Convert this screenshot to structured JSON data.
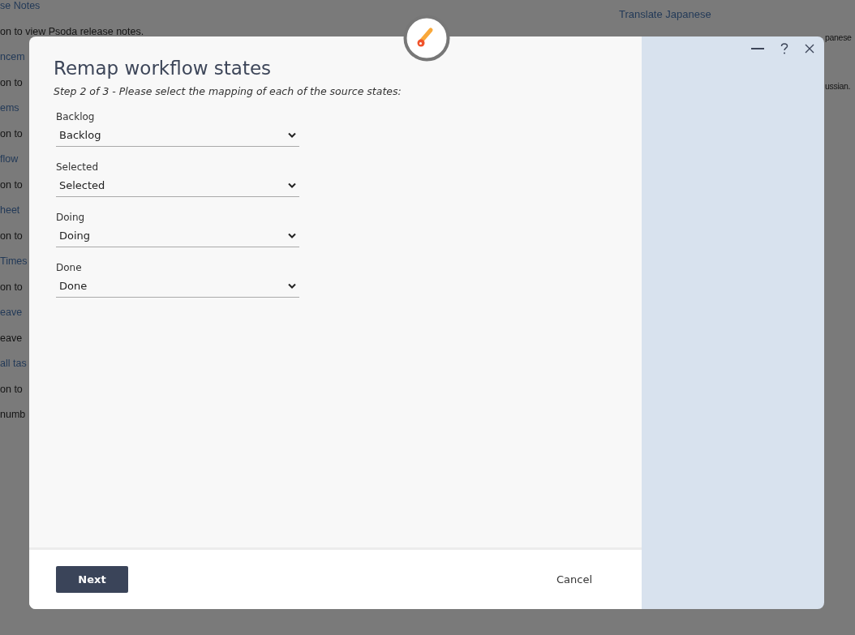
{
  "background_page": {
    "left_items": [
      {
        "kind": "link",
        "text": "se Notes"
      },
      {
        "kind": "text",
        "text": "on to view Psoda release notes."
      },
      {
        "kind": "link",
        "text": "ncem"
      },
      {
        "kind": "text",
        "text": "on to"
      },
      {
        "kind": "link",
        "text": "ems"
      },
      {
        "kind": "text",
        "text": "on to"
      },
      {
        "kind": "link",
        "text": "flow"
      },
      {
        "kind": "text",
        "text": "on to"
      },
      {
        "kind": "link",
        "text": "heet"
      },
      {
        "kind": "text",
        "text": "on to"
      },
      {
        "kind": "link",
        "text": "Times"
      },
      {
        "kind": "text",
        "text": "on to"
      },
      {
        "kind": "link",
        "text": "eave"
      },
      {
        "kind": "text",
        "text": "eave"
      },
      {
        "kind": "link",
        "text": "all tas"
      },
      {
        "kind": "text",
        "text": "on to"
      },
      {
        "kind": "text",
        "text": "numb"
      }
    ],
    "right_items": [
      {
        "kind": "link",
        "text": "Translate Japanese"
      }
    ],
    "right_fragments": [
      "panese",
      "ussian."
    ]
  },
  "dialog": {
    "title": "Remap workflow states",
    "subtitle": "Step 2 of 3 - Please select the mapping of each of the source states:",
    "fields": [
      {
        "label": "Backlog",
        "value": "Backlog"
      },
      {
        "label": "Selected",
        "value": "Selected"
      },
      {
        "label": "Doing",
        "value": "Doing"
      },
      {
        "label": "Done",
        "value": "Done"
      }
    ],
    "next_button": "Next",
    "cancel_button": "Cancel"
  }
}
